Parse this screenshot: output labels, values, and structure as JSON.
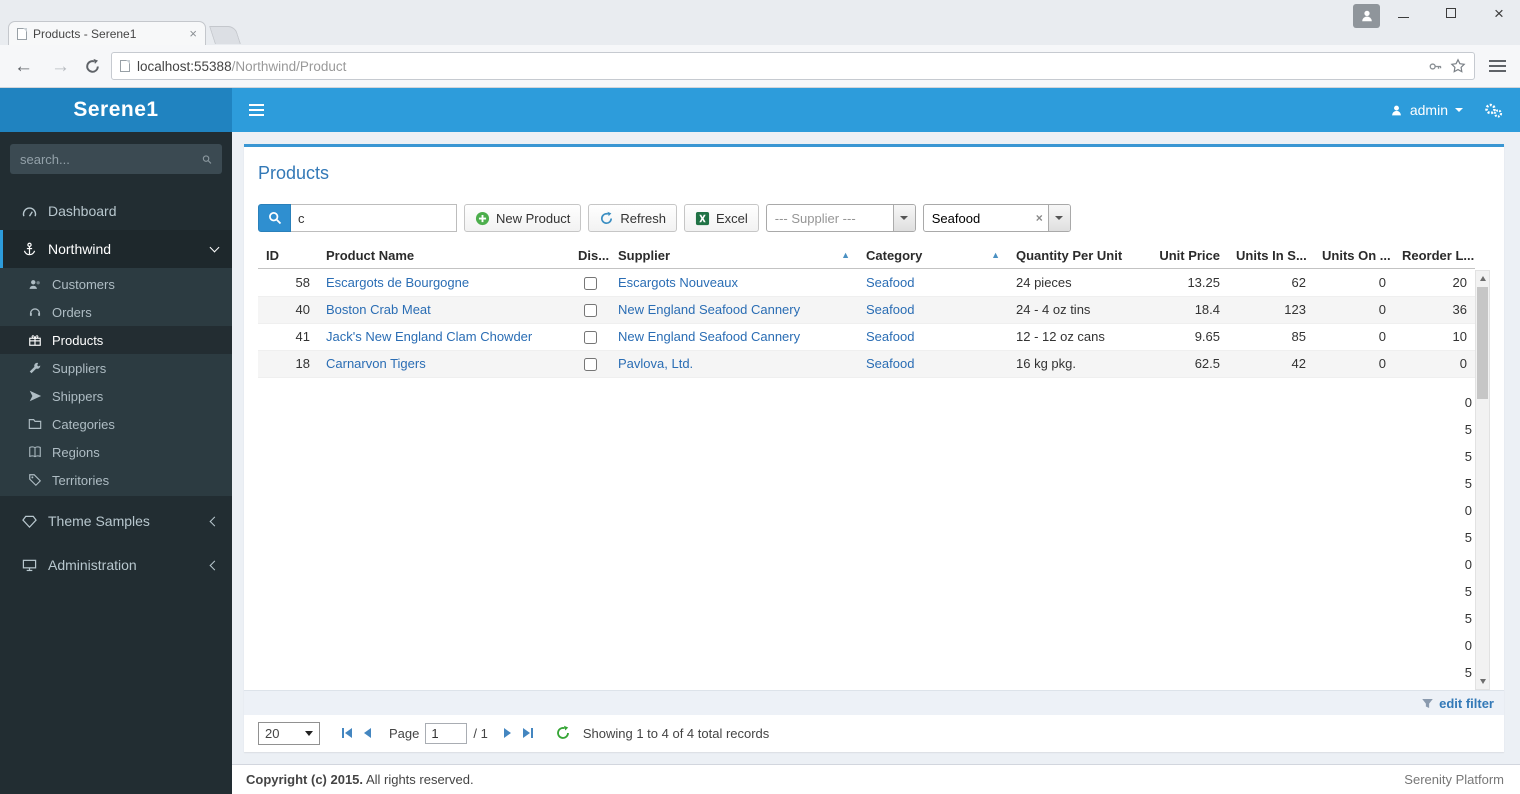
{
  "browser": {
    "tab_title": "Products - Serene1",
    "close_glyph": "×",
    "nav": {
      "back": "←",
      "forward": "→"
    },
    "url": {
      "host": "localhost:55388",
      "path": "/Northwind/Product"
    }
  },
  "app": {
    "brand": "Serene1",
    "navbar": {
      "user_label": "admin"
    },
    "sidebar": {
      "search_placeholder": "search...",
      "dashboard": "Dashboard",
      "northwind": "Northwind",
      "children": [
        "Customers",
        "Orders",
        "Products",
        "Suppliers",
        "Shippers",
        "Categories",
        "Regions",
        "Territories"
      ],
      "theme_samples": "Theme Samples",
      "administration": "Administration"
    }
  },
  "panel": {
    "title": "Products",
    "toolbar": {
      "search_value": "c",
      "new_product": "New Product",
      "refresh": "Refresh",
      "excel": "Excel",
      "supplier_placeholder": "--- Supplier ---",
      "category_value": "Seafood",
      "clear_x": "×"
    },
    "grid": {
      "columns": [
        "ID",
        "Product Name",
        "Dis...",
        "Supplier",
        "Category",
        "Quantity Per Unit",
        "Unit Price",
        "Units In S...",
        "Units On ...",
        "Reorder L..."
      ],
      "sort_arrow": "▲",
      "sorted_columns": [
        "Supplier",
        "Category"
      ],
      "rows": [
        {
          "id": "58",
          "product_name": "Escargots de Bourgogne",
          "discontinued": false,
          "supplier": "Escargots Nouveaux",
          "category": "Seafood",
          "quantity_per_unit": "24 pieces",
          "unit_price": "13.25",
          "units_in_stock": "62",
          "units_on_order": "0",
          "reorder_level": "20"
        },
        {
          "id": "40",
          "product_name": "Boston Crab Meat",
          "discontinued": false,
          "supplier": "New England Seafood Cannery",
          "category": "Seafood",
          "quantity_per_unit": "24 - 4 oz tins",
          "unit_price": "18.4",
          "units_in_stock": "123",
          "units_on_order": "0",
          "reorder_level": "36"
        },
        {
          "id": "41",
          "product_name": "Jack's New England Clam Chowder",
          "discontinued": false,
          "supplier": "New England Seafood Cannery",
          "category": "Seafood",
          "quantity_per_unit": "12 - 12 oz cans",
          "unit_price": "9.65",
          "units_in_stock": "85",
          "units_on_order": "0",
          "reorder_level": "10"
        },
        {
          "id": "18",
          "product_name": "Carnarvon Tigers",
          "discontinued": false,
          "supplier": "Pavlova, Ltd.",
          "category": "Seafood",
          "quantity_per_unit": "16 kg pkg.",
          "unit_price": "62.5",
          "units_in_stock": "42",
          "units_on_order": "0",
          "reorder_level": "0"
        }
      ],
      "ghost_values": [
        "0",
        "5",
        "5",
        "5",
        "0",
        "5",
        "0",
        "5",
        "5",
        "0",
        "5"
      ]
    },
    "filter_bar": {
      "edit_filter": "edit filter"
    },
    "pager": {
      "page_size": "20",
      "page_label": "Page",
      "page_value": "1",
      "page_total": "/ 1",
      "status": "Showing 1 to 4 of 4 total records"
    }
  },
  "footer": {
    "copyright_bold": "Copyright (c) 2015.",
    "copyright_rest": "All rights reserved.",
    "right": "Serenity Platform"
  },
  "icons": {
    "search": "magnifier",
    "new_product": "green-plus-circle",
    "refresh": "blue-circular-arrow",
    "excel": "green-square-x",
    "edit_filter": "funnel",
    "user": "person-silhouette",
    "settings": "gears"
  },
  "colors": {
    "navbar": "#2d9cdb",
    "brand_bg": "#2083c0",
    "sidebar_bg": "#222d32",
    "link": "#2a6db4",
    "panel_top_border": "#3996d3"
  }
}
